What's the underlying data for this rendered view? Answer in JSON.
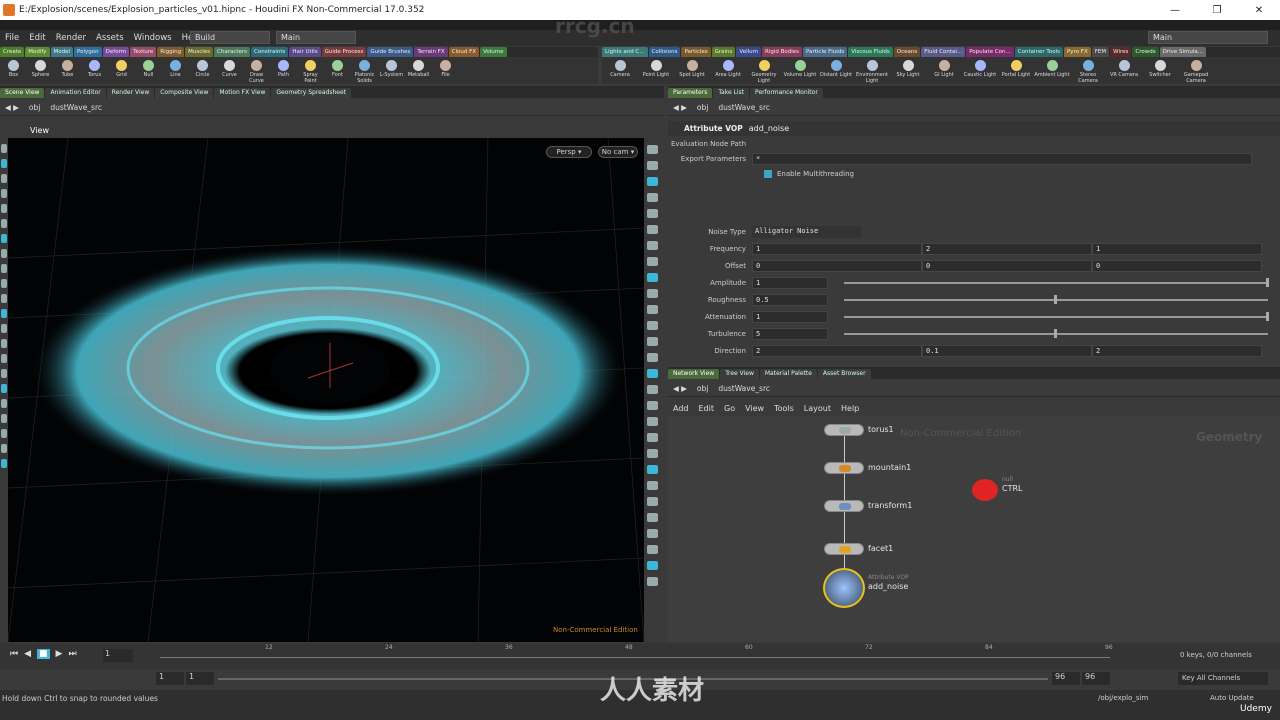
{
  "window": {
    "title": "E:/Explosion/scenes/Explosion_particles_v01.hipnc - Houdini FX Non-Commercial 17.0.352",
    "buttons": [
      "—",
      "❐",
      "✕"
    ]
  },
  "menu": [
    "File",
    "Edit",
    "Render",
    "Assets",
    "Windows",
    "Help"
  ],
  "desktop_left": "Build",
  "desktop_right": "Main",
  "desktop_far_right": "Main",
  "shelf_tabs_left": [
    "Create",
    "Modify",
    "Model",
    "Polygon",
    "Deform",
    "Texture",
    "Rigging",
    "Muscles",
    "Characters",
    "Constraints",
    "Hair Utils",
    "Guide Process",
    "Guide Brushes",
    "Terrain FX",
    "Cloud FX",
    "Volume"
  ],
  "shelf_tabs_right": [
    "Lights and C...",
    "Collisions",
    "Particles",
    "Grains",
    "Vellum",
    "Rigid Bodies",
    "Particle Fluids",
    "Viscous Fluids",
    "Oceans",
    "Fluid Contai...",
    "Populate Con...",
    "Container Tools",
    "Pyro FX",
    "FEM",
    "Wires",
    "Crowds",
    "Drive Simula..."
  ],
  "tools_left": [
    "Box",
    "Sphere",
    "Tube",
    "Torus",
    "Grid",
    "Null",
    "Line",
    "Circle",
    "Curve",
    "Draw Curve",
    "Path",
    "Spray Paint",
    "Font",
    "Platonic Solids",
    "L-System",
    "Metaball",
    "File"
  ],
  "tools_right": [
    "Camera",
    "Point Light",
    "Spot Light",
    "Area Light",
    "Geometry Light",
    "Volume Light",
    "Distant Light",
    "Environment Light",
    "Sky Light",
    "GI Light",
    "Caustic Light",
    "Portal Light",
    "Ambient Light",
    "Stereo Camera",
    "VR Camera",
    "Switcher",
    "Gamepad Camera"
  ],
  "pane_tabs_left": [
    "Scene View",
    "Animation Editor",
    "Render View",
    "Composite View",
    "Motion FX View",
    "Geometry Spreadsheet"
  ],
  "pane_tabs_right_top": [
    "Parameters",
    "Take List",
    "Performance Monitor"
  ],
  "pane_tabs_right_bottom": [
    "Network View",
    "Tree View",
    "Material Palette",
    "Asset Browser"
  ],
  "path": {
    "root": "obj",
    "node": "dustWave_src"
  },
  "viewport": {
    "title": "View",
    "persp": "Persp ▾",
    "cam": "No cam ▾",
    "watermark": "Non-Commercial Edition"
  },
  "params": {
    "node_type": "Attribute VOP",
    "node_name": "add_noise",
    "eval_path_label": "Evaluation Node Path",
    "export_label": "Export Parameters",
    "export_value": "*",
    "multithread_label": "Enable Multithreading",
    "noise_type_label": "Noise Type",
    "noise_type": "Alligator Noise",
    "rows": [
      {
        "label": "Frequency",
        "values": [
          "1",
          "2",
          "1"
        ]
      },
      {
        "label": "Offset",
        "values": [
          "0",
          "0",
          "0"
        ]
      },
      {
        "label": "Amplitude",
        "values": [
          "1"
        ],
        "slider": 1.0
      },
      {
        "label": "Roughness",
        "values": [
          "0.5"
        ],
        "slider": 0.5
      },
      {
        "label": "Attenuation",
        "values": [
          "1"
        ],
        "slider": 1.0
      },
      {
        "label": "Turbulence",
        "values": [
          "5"
        ],
        "slider": 0.5
      },
      {
        "label": "Direction",
        "values": [
          "2",
          "0.1",
          "2"
        ]
      }
    ]
  },
  "network": {
    "menu": [
      "Add",
      "Edit",
      "Go",
      "View",
      "Tools",
      "Layout",
      "Help"
    ],
    "nc_text": "Non-Commercial Edition",
    "context": "Geometry",
    "nodes": [
      "torus1",
      "mountain1",
      "transform1",
      "facet1",
      "add_noise"
    ],
    "vop_type": "Attribute VOP",
    "null_type": "null",
    "null_name": "CTRL"
  },
  "timeline": {
    "frame": "1",
    "ticks": [
      "12",
      "24",
      "36",
      "48",
      "60",
      "72",
      "84",
      "96"
    ],
    "start": "1",
    "start2": "1",
    "end": "96",
    "end2": "96",
    "keys": "0 keys, 0/0 channels",
    "key_all": "Key All Channels"
  },
  "status": {
    "hint": "Hold down Ctrl to snap to rounded values",
    "path": "/obj/explo_sim",
    "update": "Auto Update"
  },
  "watermarks": [
    "rrcg.cn",
    "人人素材",
    "Udemy"
  ]
}
